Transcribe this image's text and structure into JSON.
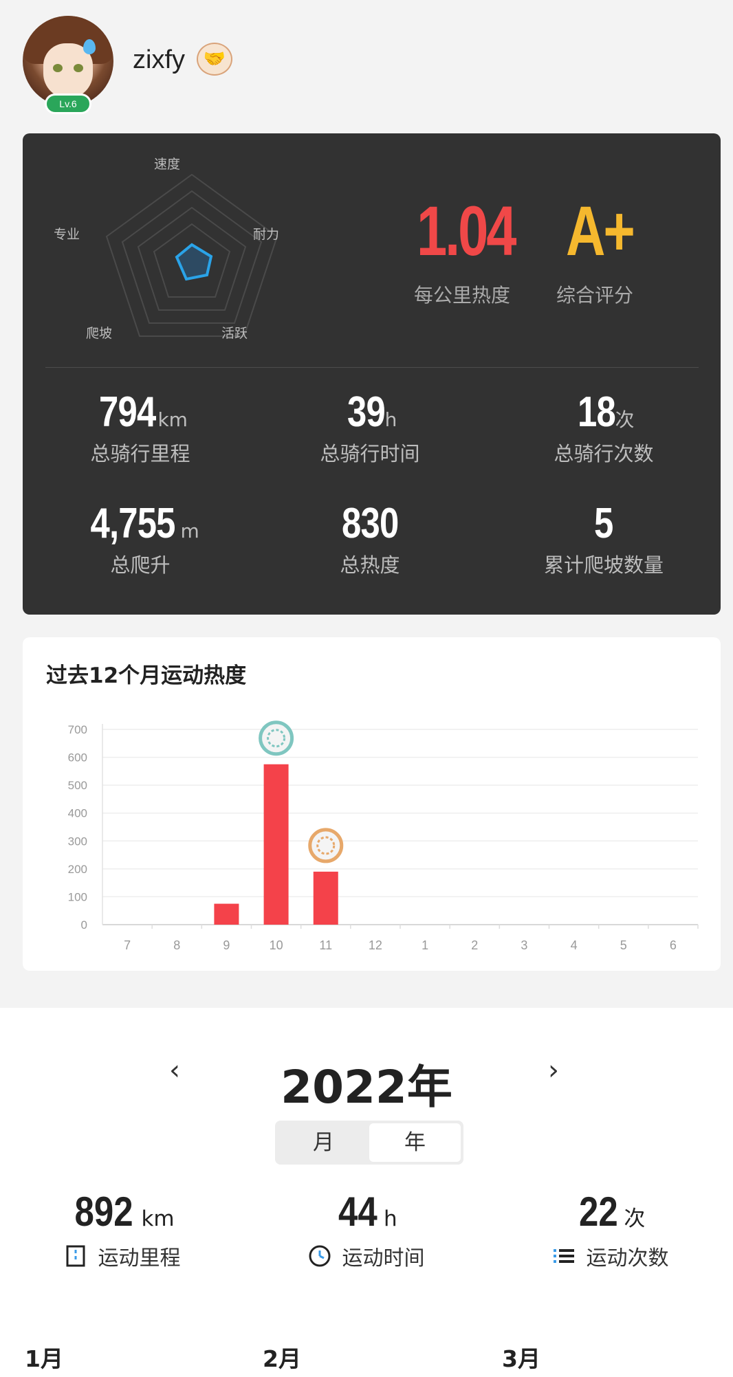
{
  "profile": {
    "username": "zixfy",
    "level": "Lv.6",
    "badge_icon": "handshake-icon"
  },
  "summary": {
    "radar_labels": {
      "top": "速度",
      "right": "耐力",
      "bottom_right": "活跃",
      "bottom_left": "爬坡",
      "left": "专业"
    },
    "heat_per_km": {
      "value": "1.04",
      "label": "每公里热度",
      "color": "#f04848"
    },
    "overall_rating": {
      "value": "A+",
      "label": "综合评分",
      "color": "#f5b82e"
    },
    "stats": [
      {
        "value": "794",
        "unit": "km",
        "label": "总骑行里程"
      },
      {
        "value": "39",
        "unit": "h",
        "label": "总骑行时间"
      },
      {
        "value": "18",
        "unit": "次",
        "label": "总骑行次数"
      },
      {
        "value": "4,755",
        "unit": "m",
        "label": "总爬升"
      },
      {
        "value": "830",
        "unit": "",
        "label": "总热度"
      },
      {
        "value": "5",
        "unit": "",
        "label": "累计爬坡数量"
      }
    ]
  },
  "chart_title": "过去12个月运动热度",
  "chart_data": {
    "type": "bar",
    "title": "过去12个月运动热度",
    "categories": [
      "7",
      "8",
      "9",
      "10",
      "11",
      "12",
      "1",
      "2",
      "3",
      "4",
      "5",
      "6"
    ],
    "values": [
      0,
      0,
      75,
      575,
      190,
      0,
      0,
      0,
      0,
      0,
      0,
      0
    ],
    "ylim": [
      0,
      700
    ],
    "yticks": [
      "0",
      "100",
      "200",
      "300",
      "400",
      "500",
      "600",
      "700"
    ],
    "grid": true,
    "bar_color": "#f4424a",
    "medals": [
      {
        "category": "10",
        "color": "#7fc6c0"
      },
      {
        "category": "11",
        "color": "#e7a86a"
      }
    ]
  },
  "year_view": {
    "prev_icon": "chevron-left-icon",
    "next_icon": "chevron-right-icon",
    "title": "2022年",
    "tabs": [
      "月",
      "年"
    ],
    "active_tab": "年",
    "stats": [
      {
        "value": "892",
        "unit": "km",
        "label": "运动里程",
        "icon": "road-icon"
      },
      {
        "value": "44",
        "unit": "h",
        "label": "运动时间",
        "icon": "clock-icon"
      },
      {
        "value": "22",
        "unit": "次",
        "label": "运动次数",
        "icon": "list-icon"
      }
    ],
    "months": [
      "1月",
      "2月",
      "3月"
    ]
  }
}
